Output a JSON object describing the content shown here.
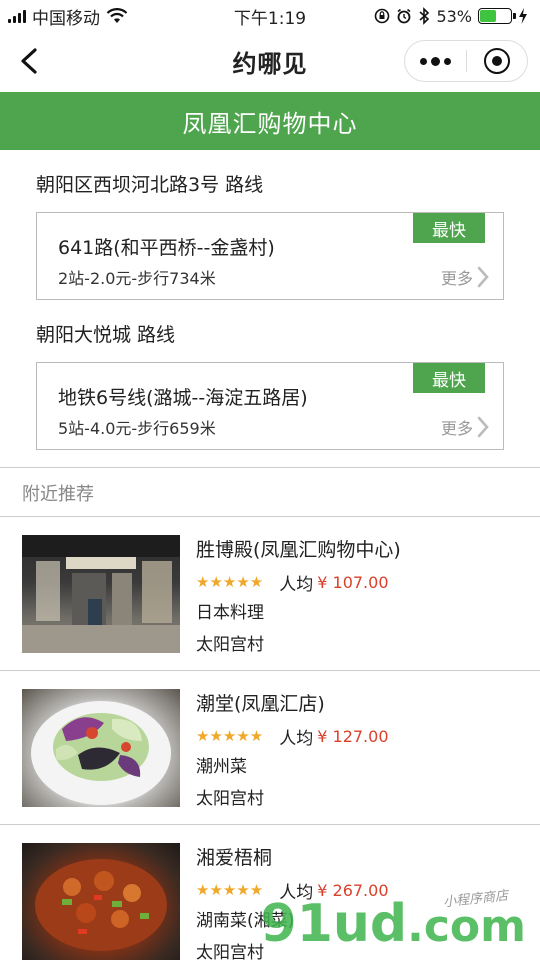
{
  "status_bar": {
    "carrier": "中国移动",
    "time": "下午1:19",
    "battery_percent": "53%",
    "battery_level": 0.53,
    "icons": [
      "wifi-icon",
      "screen-lock-icon",
      "alarm-icon",
      "bluetooth-icon",
      "battery-icon",
      "charging-icon"
    ]
  },
  "nav": {
    "title": "约哪见",
    "back_icon": "chevron-left-icon",
    "menu_icon": "more-dots-icon",
    "close_icon": "target-close-icon"
  },
  "banner": {
    "title": "凤凰汇购物中心"
  },
  "routes": [
    {
      "heading": "朝阳区西坝河北路3号 路线",
      "badge": "最快",
      "line": "641路(和平西桥--金盏村)",
      "detail": "2站-2.0元-步行734米",
      "more": "更多"
    },
    {
      "heading": "朝阳大悦城 路线",
      "badge": "最快",
      "line": "地铁6号线(潞城--海淀五路居)",
      "detail": "5站-4.0元-步行659米",
      "more": "更多"
    }
  ],
  "nearby": {
    "title": "附近推荐",
    "items": [
      {
        "name": "胜博殿(凤凰汇购物中心)",
        "avg_label": "人均",
        "price": "¥ 107.00",
        "rating": 5,
        "cuisine": "日本料理",
        "area": "太阳宫村"
      },
      {
        "name": "潮堂(凤凰汇店)",
        "avg_label": "人均",
        "price": "¥ 127.00",
        "rating": 5,
        "cuisine": "潮州菜",
        "area": "太阳宫村"
      },
      {
        "name": "湘爱梧桐",
        "avg_label": "人均",
        "price": "¥ 267.00",
        "rating": 5,
        "cuisine": "湖南菜(湘菜)",
        "area": "太阳宫村"
      }
    ]
  },
  "watermark": {
    "brand": "91ud",
    "suffix": ".com",
    "tagline": "小程序商店"
  },
  "colors": {
    "accent": "#4ea54d",
    "price": "#d9412b",
    "star": "#f0a82a"
  }
}
